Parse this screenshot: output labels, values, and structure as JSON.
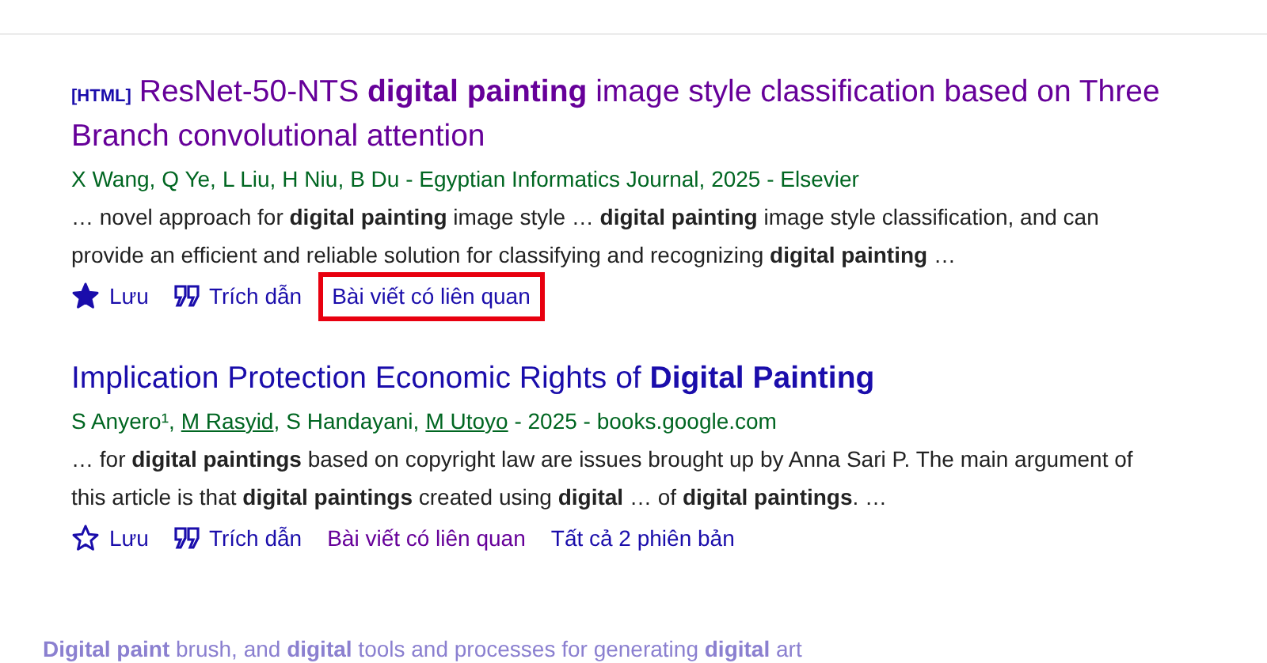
{
  "results": [
    {
      "tag": "[HTML]",
      "title": "ResNet-50-NTS **digital painting** image style classification based on Three Branch convolutional attention",
      "visited": true,
      "authors": [
        {
          "text": "X Wang",
          "linked": false,
          "sep": ","
        },
        {
          "text": "Q Ye",
          "linked": false,
          "sep": ","
        },
        {
          "text": "L Liu",
          "linked": false,
          "sep": ","
        },
        {
          "text": "H Niu",
          "linked": false,
          "sep": ","
        },
        {
          "text": "B Du",
          "linked": false
        }
      ],
      "source": " - Egyptian Informatics Journal, 2025 - Elsevier",
      "snippet": "… novel approach for **digital painting** image style … **digital painting** image style classification, and can provide an efficient and reliable solution for classifying and recognizing **digital painting** …",
      "saved": true,
      "actions": [
        {
          "kind": "save",
          "label": "Lưu"
        },
        {
          "kind": "cite",
          "label": "Trích dẫn"
        },
        {
          "kind": "link",
          "label": "Bài viết có liên quan",
          "visited": false,
          "highlighted": true
        }
      ]
    },
    {
      "title": "Implication Protection Economic Rights of **Digital Painting**",
      "visited": false,
      "authors": [
        {
          "text": "S Anyero¹",
          "linked": false,
          "sep": ","
        },
        {
          "text": "M Rasyid",
          "linked": true,
          "sep": ","
        },
        {
          "text": "S Handayani",
          "linked": false,
          "sep": ","
        },
        {
          "text": "M Utoyo",
          "linked": true
        }
      ],
      "source": " - 2025 - books.google.com",
      "snippet": "… for **digital paintings** based on copyright law are issues brought up by Anna Sari P. The main argument of this article is that **digital paintings** created using **digital** … of **digital paintings**. …",
      "saved": false,
      "actions": [
        {
          "kind": "save",
          "label": "Lưu"
        },
        {
          "kind": "cite",
          "label": "Trích dẫn"
        },
        {
          "kind": "link",
          "label": "Bài viết có liên quan",
          "visited": true,
          "highlighted": false
        },
        {
          "kind": "link",
          "label": "Tất cả 2 phiên bản",
          "visited": false,
          "highlighted": false
        }
      ]
    }
  ],
  "footer_text": "**Digital paint** brush, and **digital** tools and processes for generating **digital** art"
}
